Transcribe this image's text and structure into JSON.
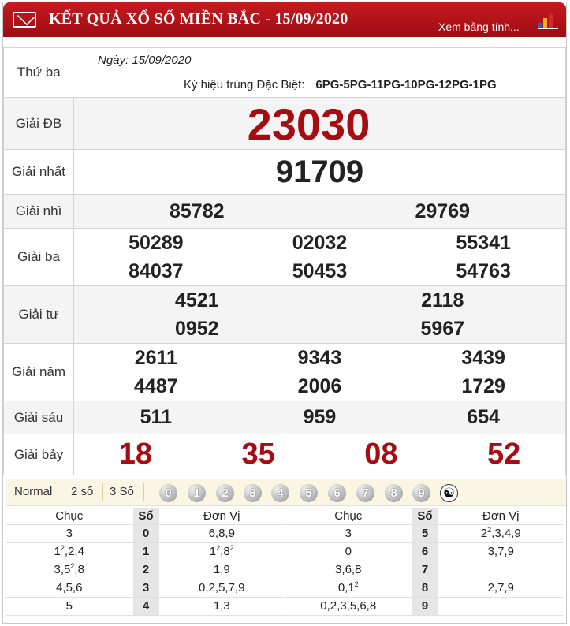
{
  "header": {
    "title": "KẾT QUẢ XỔ SỐ MIỀN BẮC - 15/09/2020",
    "view_link": "Xem bảng tính..."
  },
  "info": {
    "weekday": "Thứ ba",
    "date": "Ngày: 15/09/2020",
    "code_label": "Ký hiệu trúng Đặc Biệt:",
    "code_value": "6PG-5PG-11PG-10PG-12PG-1PG"
  },
  "prizes": [
    {
      "label": "Giải ĐB",
      "numbers": [
        "23030"
      ]
    },
    {
      "label": "Giải nhất",
      "numbers": [
        "91709"
      ]
    },
    {
      "label": "Giải nhì",
      "numbers": [
        "85782",
        "29769"
      ]
    },
    {
      "label": "Giải ba",
      "numbers": [
        "50289",
        "02032",
        "55341",
        "84037",
        "50453",
        "54763"
      ]
    },
    {
      "label": "Giải tư",
      "numbers": [
        "4521",
        "2118",
        "0952",
        "5967"
      ]
    },
    {
      "label": "Giải năm",
      "numbers": [
        "2611",
        "9343",
        "3439",
        "4487",
        "2006",
        "1729"
      ]
    },
    {
      "label": "Giải sáu",
      "numbers": [
        "511",
        "959",
        "654"
      ]
    },
    {
      "label": "Giải bảy",
      "numbers": [
        "18",
        "35",
        "08",
        "52"
      ]
    }
  ],
  "tabs": [
    "Normal",
    "2 số",
    "3 Số"
  ],
  "digit_balls": [
    "0",
    "1",
    "2",
    "3",
    "4",
    "5",
    "6",
    "7",
    "8",
    "9"
  ],
  "loto_headers": {
    "chuc": "Chục",
    "so": "Số",
    "donvi": "Đơn Vị"
  },
  "loto_left": [
    {
      "chuc": "3",
      "so": "0",
      "donvi": "6,8,9"
    },
    {
      "chuc": "1²,2,4",
      "so": "1",
      "donvi": "1²,8²"
    },
    {
      "chuc": "3,5²,8",
      "so": "2",
      "donvi": "1,9"
    },
    {
      "chuc": "4,5,6",
      "so": "3",
      "donvi": "0,2,5,7,9"
    },
    {
      "chuc": "5",
      "so": "4",
      "donvi": "1,3"
    }
  ],
  "loto_right": [
    {
      "chuc": "3",
      "so": "5",
      "donvi": "2²,3,4,9"
    },
    {
      "chuc": "0",
      "so": "6",
      "donvi": "3,7,9"
    },
    {
      "chuc": "3,6,8",
      "so": "7",
      "donvi": ""
    },
    {
      "chuc": "0,1²",
      "so": "8",
      "donvi": "2,7,9"
    },
    {
      "chuc": "0,2,3,5,6,8",
      "so": "9",
      "donvi": ""
    }
  ],
  "colors": {
    "header_red": "#b3141a",
    "number_red": "#a50d12",
    "tab_bg": "#fbf6e4"
  }
}
